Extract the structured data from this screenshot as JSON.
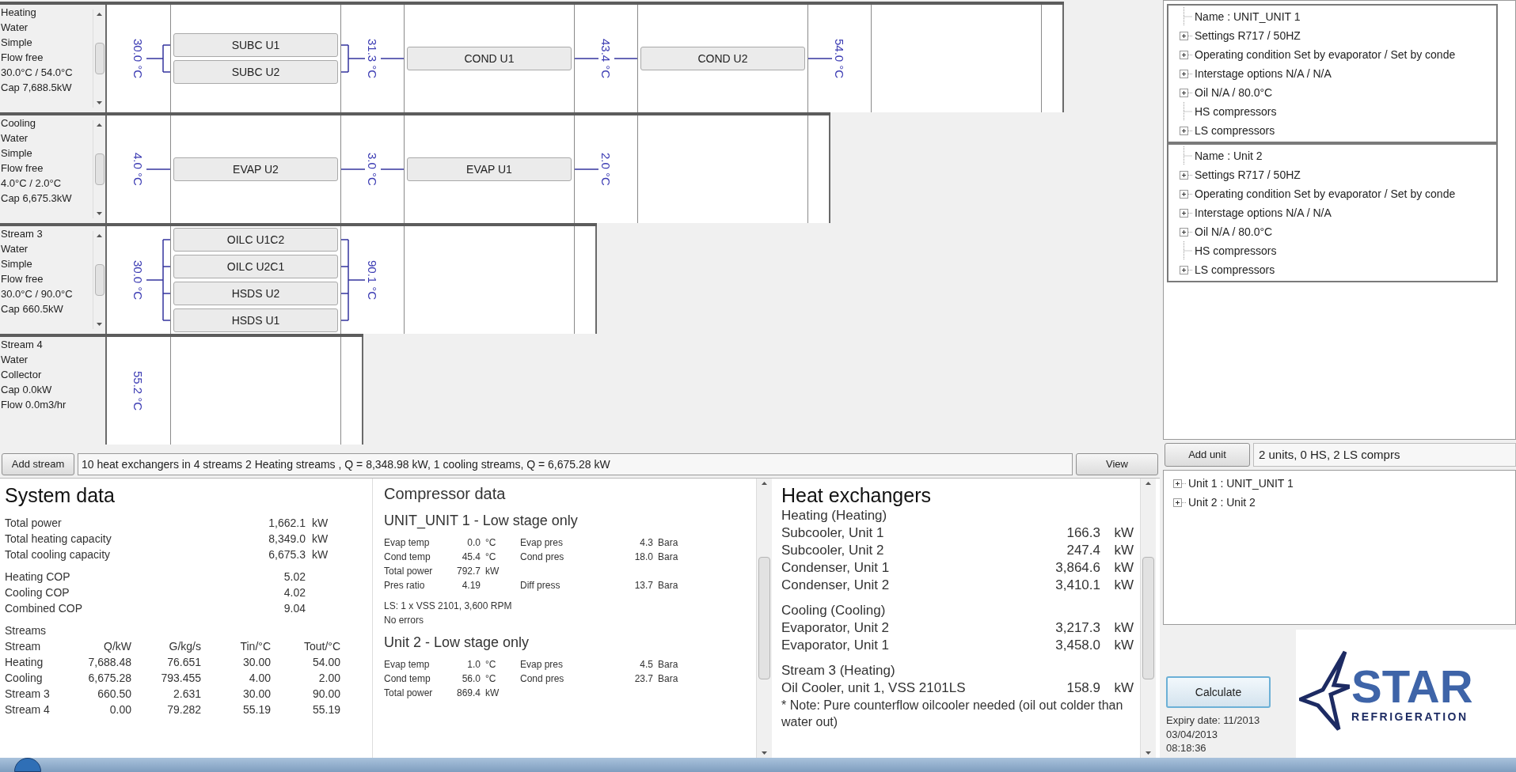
{
  "diagram": {
    "streams": [
      {
        "lines": [
          "Heating",
          "Water",
          "Simple",
          "Flow free",
          "30.0°C / 54.0°C",
          "Cap 7,688.5kW"
        ],
        "scrollable": true,
        "temperatures": [
          "30.0 °C",
          "31.3 °C",
          "43.4 °C",
          "54.0 °C"
        ],
        "exchanger_groups": [
          [
            "SUBC U1",
            "SUBC U2"
          ],
          [
            "COND U1"
          ],
          [
            "COND U2"
          ]
        ]
      },
      {
        "lines": [
          "Cooling",
          "Water",
          "Simple",
          "Flow free",
          "4.0°C / 2.0°C",
          "Cap 6,675.3kW"
        ],
        "scrollable": true,
        "temperatures": [
          "4.0 °C",
          "3.0 °C",
          "2.0 °C"
        ],
        "exchanger_groups": [
          [
            "EVAP U2"
          ],
          [
            "EVAP U1"
          ]
        ]
      },
      {
        "lines": [
          "Stream 3",
          "Water",
          "Simple",
          "Flow free",
          "30.0°C / 90.0°C",
          "Cap 660.5kW"
        ],
        "scrollable": true,
        "temperatures": [
          "30.0 °C",
          "90.1 °C"
        ],
        "exchanger_groups": [
          [
            "OILC U1C2",
            "OILC U2C1",
            "HSDS U2",
            "HSDS U1"
          ]
        ]
      },
      {
        "lines": [
          "Stream 4",
          "Water",
          "Collector",
          "Cap 0.0kW",
          "Flow 0.0m3/hr"
        ],
        "scrollable": false,
        "temperatures": [
          "55.2 °C"
        ]
      }
    ]
  },
  "stream_bar": {
    "add_button": "Add stream",
    "summary": "10 heat exchangers in 4 streams  2 Heating streams , Q = 8,348.98 kW, 1 cooling streams, Q = 6,675.28 kW",
    "view_button": "View"
  },
  "units_panel": {
    "units": [
      {
        "items": [
          {
            "text": "Name : UNIT_UNIT 1",
            "expandable": false
          },
          {
            "text": "Settings R717 / 50HZ",
            "expandable": true
          },
          {
            "text": "Operating condition Set by evaporator / Set by conde",
            "expandable": true
          },
          {
            "text": "Interstage options N/A / N/A",
            "expandable": true
          },
          {
            "text": "Oil N/A / 80.0°C",
            "expandable": true
          },
          {
            "text": "HS compressors",
            "expandable": false
          },
          {
            "text": "LS compressors",
            "expandable": true
          }
        ]
      },
      {
        "items": [
          {
            "text": "Name : Unit 2",
            "expandable": false
          },
          {
            "text": "Settings R717 / 50HZ",
            "expandable": true
          },
          {
            "text": "Operating condition Set by evaporator / Set by conde",
            "expandable": true
          },
          {
            "text": "Interstage options N/A / N/A",
            "expandable": true
          },
          {
            "text": "Oil N/A / 80.0°C",
            "expandable": true
          },
          {
            "text": "HS compressors",
            "expandable": false
          },
          {
            "text": "LS compressors",
            "expandable": true
          }
        ]
      }
    ],
    "add_button": "Add unit",
    "summary": "2 units, 0 HS, 2 LS comprs"
  },
  "system_data": {
    "title": "System data",
    "groups": [
      [
        {
          "label": "Total power",
          "value": "1,662.1",
          "unit": "kW"
        },
        {
          "label": "Total heating capacity",
          "value": "8,349.0",
          "unit": "kW"
        },
        {
          "label": "Total cooling capacity",
          "value": "6,675.3",
          "unit": "kW"
        }
      ],
      [
        {
          "label": "Heating COP",
          "value": "5.02"
        },
        {
          "label": "Cooling COP",
          "value": "4.02"
        },
        {
          "label": "Combined COP",
          "value": "9.04"
        }
      ]
    ],
    "streams_caption": "Streams",
    "streams_header": [
      "Stream",
      "Q/kW",
      "G/kg/s",
      "Tin/°C",
      "Tout/°C"
    ],
    "streams_rows": [
      [
        "Heating",
        "7,688.48",
        "76.651",
        "30.00",
        "54.00"
      ],
      [
        "Cooling",
        "6,675.28",
        "793.455",
        "4.00",
        "2.00"
      ],
      [
        "Stream 3",
        "660.50",
        "2.631",
        "30.00",
        "90.00"
      ],
      [
        "Stream 4",
        "0.00",
        "79.282",
        "55.19",
        "55.19"
      ]
    ]
  },
  "compressor_data": {
    "title": "Compressor data",
    "units": [
      {
        "heading": "UNIT_UNIT 1 - Low stage only",
        "rows": [
          [
            {
              "label": "Evap temp",
              "value": "0.0",
              "unit": "°C"
            },
            {
              "label": "Evap pres",
              "value": "4.3",
              "unit": "Bara"
            }
          ],
          [
            {
              "label": "Cond temp",
              "value": "45.4",
              "unit": "°C"
            },
            {
              "label": "Cond pres",
              "value": "18.0",
              "unit": "Bara"
            }
          ],
          [
            {
              "label": "Total power",
              "value": "792.7",
              "unit": "kW"
            }
          ],
          [
            {
              "label": "Pres ratio",
              "value": "4.19"
            },
            {
              "label": "Diff press",
              "value": "13.7",
              "unit": "Bara"
            }
          ]
        ],
        "notes": [
          "LS: 1 x VSS 2101, 3,600 RPM",
          "No errors"
        ]
      },
      {
        "heading": "Unit 2 - Low stage only",
        "rows": [
          [
            {
              "label": "Evap temp",
              "value": "1.0",
              "unit": "°C"
            },
            {
              "label": "Evap pres",
              "value": "4.5",
              "unit": "Bara"
            }
          ],
          [
            {
              "label": "Cond temp",
              "value": "56.0",
              "unit": "°C"
            },
            {
              "label": "Cond pres",
              "value": "23.7",
              "unit": "Bara"
            }
          ],
          [
            {
              "label": "Total power",
              "value": "869.4",
              "unit": "kW"
            }
          ]
        ]
      }
    ]
  },
  "heat_exchangers": {
    "title": "Heat exchangers",
    "groups": [
      {
        "heading": "Heating (Heating)",
        "items": [
          {
            "name": "Subcooler, Unit 1",
            "value": "166.3",
            "unit": "kW"
          },
          {
            "name": "Subcooler, Unit 2",
            "value": "247.4",
            "unit": "kW"
          },
          {
            "name": "Condenser, Unit 1",
            "value": "3,864.6",
            "unit": "kW"
          },
          {
            "name": "Condenser, Unit 2",
            "value": "3,410.1",
            "unit": "kW"
          }
        ]
      },
      {
        "heading": "Cooling (Cooling)",
        "items": [
          {
            "name": "Evaporator, Unit 2",
            "value": "3,217.3",
            "unit": "kW"
          },
          {
            "name": "Evaporator, Unit 1",
            "value": "3,458.0",
            "unit": "kW"
          }
        ]
      },
      {
        "heading": "Stream 3 (Heating)",
        "items": [
          {
            "name": "Oil Cooler, unit 1, VSS 2101LS",
            "value": "158.9",
            "unit": "kW"
          }
        ],
        "note": "* Note: Pure counterflow oilcooler needed (oil out colder than water out)"
      }
    ]
  },
  "unit_tree": [
    {
      "text": "Unit 1 : UNIT_UNIT 1",
      "expandable": true
    },
    {
      "text": "Unit 2 : Unit 2",
      "expandable": true
    }
  ],
  "calculate_button": "Calculate",
  "expiry": "Expiry date: 11/2013",
  "date": "03/04/2013",
  "time": "08:18:36",
  "logo": {
    "word": "STAR",
    "tagline": "REFRIGERATION"
  }
}
